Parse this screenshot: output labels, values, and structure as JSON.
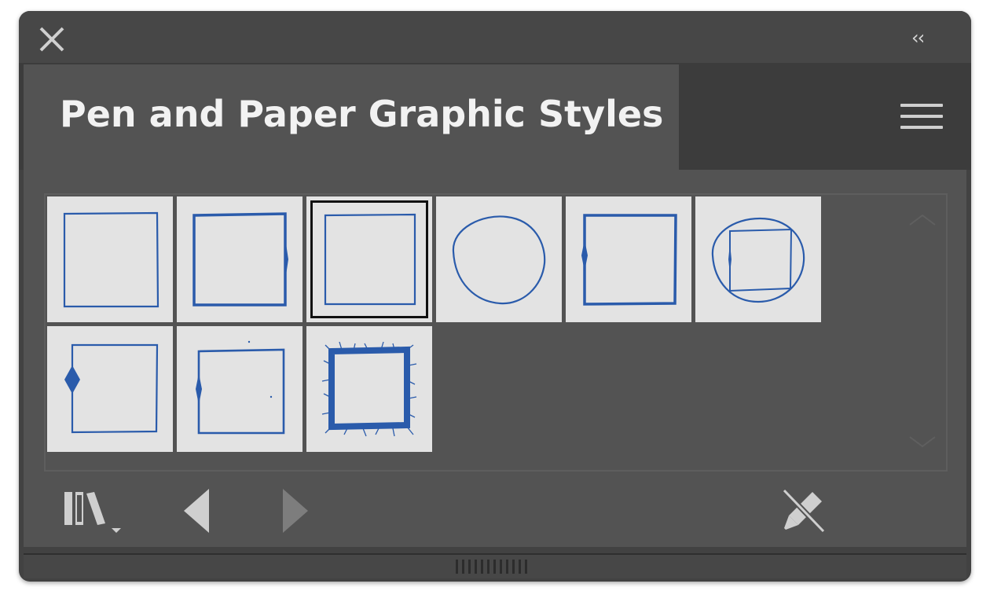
{
  "window": {
    "close_icon": "close-icon",
    "collapse_label": "‹‹"
  },
  "panel": {
    "title": "Pen and Paper Graphic Styles",
    "menu_icon": "hamburger-menu-icon"
  },
  "styles": {
    "accent_color": "#2a5bab",
    "swatch_bg": "#e3e3e3",
    "selected_index": 2,
    "count": 9
  },
  "footer": {
    "library_icon": "library-menu-icon",
    "prev_icon": "previous-library-icon",
    "next_icon": "next-library-icon",
    "break_link_icon": "break-link-icon"
  }
}
